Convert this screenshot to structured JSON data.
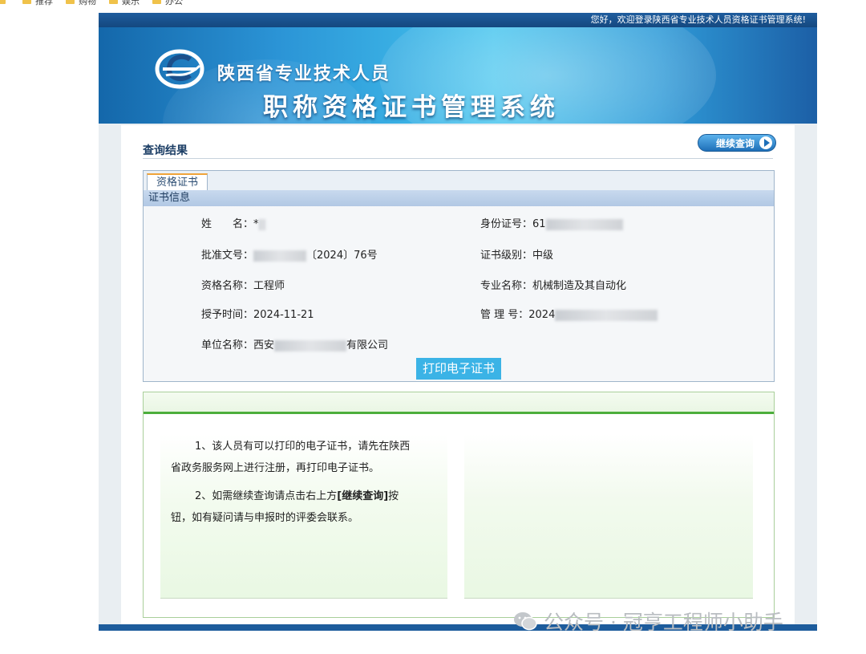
{
  "bookmarks": [
    "",
    "推荐",
    "购物",
    "娱乐",
    "办公"
  ],
  "header": {
    "welcome": "您好，欢迎登录陕西省专业技术人员资格证书管理系统!",
    "title_line1": "陕西省专业技术人员",
    "title_line2": "职称资格证书管理系统"
  },
  "result": {
    "title": "查询结果",
    "continue_button": "继续查询"
  },
  "panel": {
    "tab": "资格证书",
    "section": "证书信息",
    "fields": {
      "name_label": "姓　　名：",
      "name_value": "*",
      "id_label": "身份证号：",
      "id_value": "61",
      "approval_label": "批准文号：",
      "approval_value": "〔2024〕76号",
      "level_label": "证书级别：",
      "level_value": "中级",
      "qual_label": "资格名称：",
      "qual_value": "工程师",
      "major_label": "专业名称：",
      "major_value": "机械制造及其自动化",
      "date_label": "授予时间：",
      "date_value": "2024-11-21",
      "mgmt_label": "管 理 号：",
      "mgmt_value": "2024",
      "unit_label": "单位名称：",
      "unit_prefix": "西安",
      "unit_suffix": "有限公司"
    },
    "print_button": "打印电子证书"
  },
  "notes": {
    "p1_line1": "1、该人员有可以打印的电子证书，请先在陕西",
    "p1_line2": "省政务服务网上进行注册，再打印电子证书。",
    "p2_line1_a": "2、如需继续查询请点击右上方",
    "p2_line1_b": "[继续查询]",
    "p2_line1_c": "按",
    "p2_line2": "钮，如有疑问请与申报时的评委会联系。"
  },
  "watermark": "公众号 · 冠亨工程师小助手",
  "colors": {
    "banner_dark": "#1467aa",
    "banner_light": "#44c4ee",
    "print_button": "#3bb3e6",
    "note_border": "#4cae3b"
  }
}
